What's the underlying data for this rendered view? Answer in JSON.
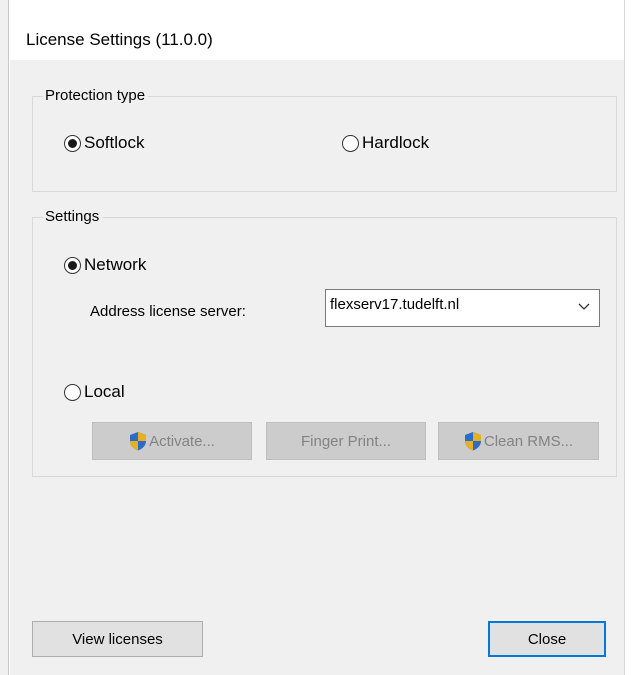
{
  "window": {
    "title": "License Settings (11.0.0)"
  },
  "protection_type": {
    "legend": "Protection type",
    "options": [
      {
        "label": "Softlock",
        "selected": true
      },
      {
        "label": "Hardlock",
        "selected": false
      }
    ]
  },
  "settings": {
    "legend": "Settings",
    "network_label": "Network",
    "network_selected": true,
    "address_label": "Address license server:",
    "address_value": "flexserv17.tudelft.nl",
    "local_label": "Local",
    "local_selected": false,
    "buttons": {
      "activate": "Activate...",
      "fingerprint": "Finger Print...",
      "clean_rms": "Clean RMS..."
    }
  },
  "footer": {
    "view_licenses": "View licenses",
    "close": "Close"
  },
  "colors": {
    "accent": "#0078d7",
    "shield_blue": "#2b6cc4",
    "shield_gold": "#e8b020"
  },
  "icons": [
    "uac-shield-icon",
    "chevron-down-icon",
    "radio-button"
  ]
}
